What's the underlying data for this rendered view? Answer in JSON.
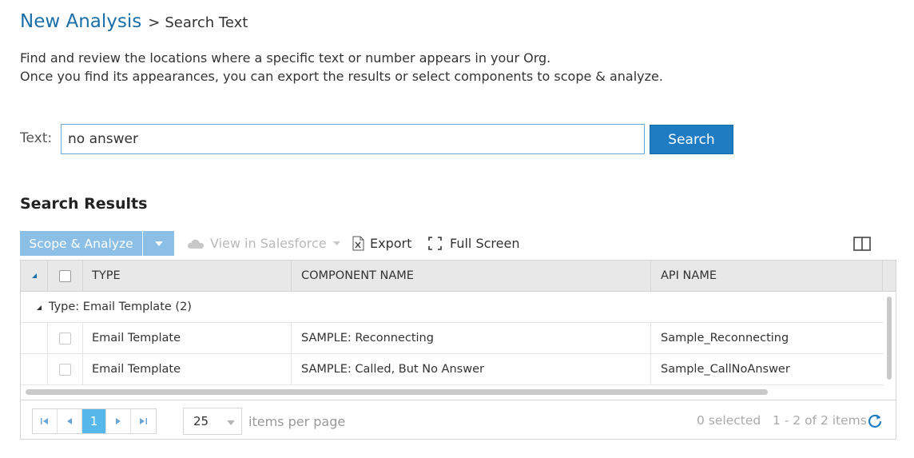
{
  "breadcrumb": {
    "parent": "New Analysis",
    "separator": ">",
    "current": "Search Text"
  },
  "description": {
    "line1": "Find and review the locations where a specific text or number appears in your Org.",
    "line2": "Once you find its appearances, you can export the results or select components to scope & analyze."
  },
  "search": {
    "label": "Text:",
    "value": "no answer",
    "button": "Search"
  },
  "results": {
    "title": "Search Results",
    "toolbar": {
      "scope_analyze": "Scope & Analyze",
      "view_in_salesforce": "View in Salesforce",
      "export": "Export",
      "full_screen": "Full Screen"
    },
    "columns": [
      "TYPE",
      "COMPONENT NAME",
      "API NAME"
    ],
    "group_label": "Type: Email Template (2)",
    "rows": [
      {
        "type": "Email Template",
        "component": "SAMPLE: Reconnecting",
        "api": "Sample_Reconnecting"
      },
      {
        "type": "Email Template",
        "component": "SAMPLE: Called, But No Answer",
        "api": "Sample_CallNoAnswer"
      }
    ],
    "pager": {
      "current_page": "1",
      "page_size": "25",
      "page_size_label": "items per page",
      "selected": "0 selected",
      "range": "1 - 2 of 2 items"
    }
  },
  "colors": {
    "link": "#1b6fa8",
    "primary_button": "#1f7cc3",
    "scope_button": "#8bbfe6",
    "active_page": "#56b7ea"
  }
}
